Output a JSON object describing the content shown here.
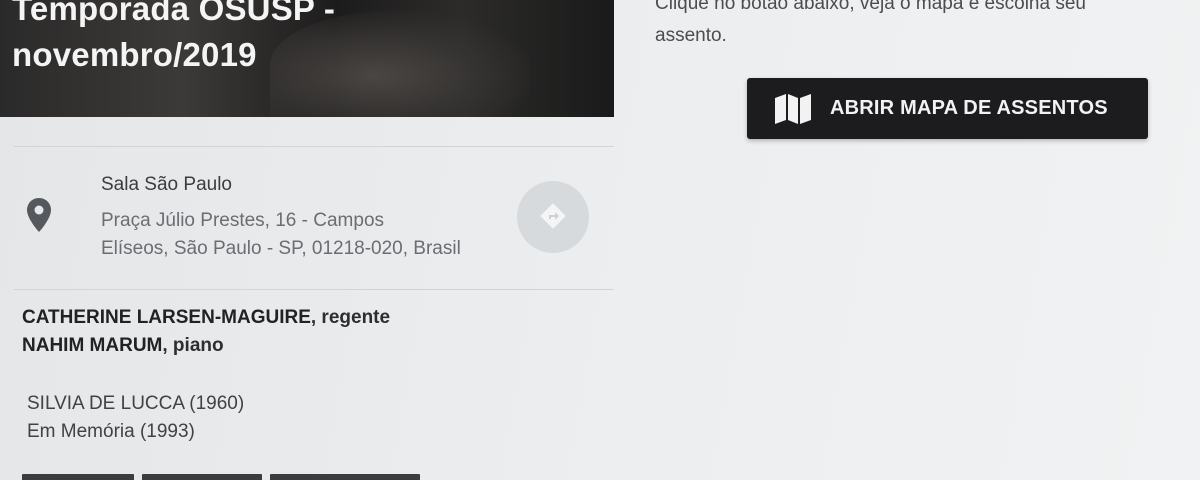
{
  "hero": {
    "title_line1": "Temporada OSUSP -",
    "title_line2": "novembro/2019"
  },
  "seating": {
    "instruction_line1": "Clique no botão abaixo, veja o mapa e escolha seu",
    "instruction_line2": "assento.",
    "button_label": "ABRIR MAPA DE ASSENTOS",
    "button_icon": "map-icon"
  },
  "venue": {
    "name": "Sala São Paulo",
    "address_line1": "Praça Júlio Prestes, 16 - Campos",
    "address_line2": "Elíseos, São Paulo - SP, 01218-020, Brasil",
    "pin_icon": "location-pin-icon",
    "directions_icon": "directions-icon"
  },
  "performers": [
    {
      "name": "CATHERINE LARSEN-MAGUIRE",
      "role": ", regente"
    },
    {
      "name": "NAHIM MARUM",
      "role": ", piano"
    }
  ],
  "program": [
    {
      "line1": "SILVIA DE LUCCA (1960)",
      "line2": "Em Memória (1993)"
    }
  ],
  "colors": {
    "button_bg": "#1c1c1e",
    "button_text": "#f2f2f2",
    "page_bg": "#e6e8ea"
  }
}
